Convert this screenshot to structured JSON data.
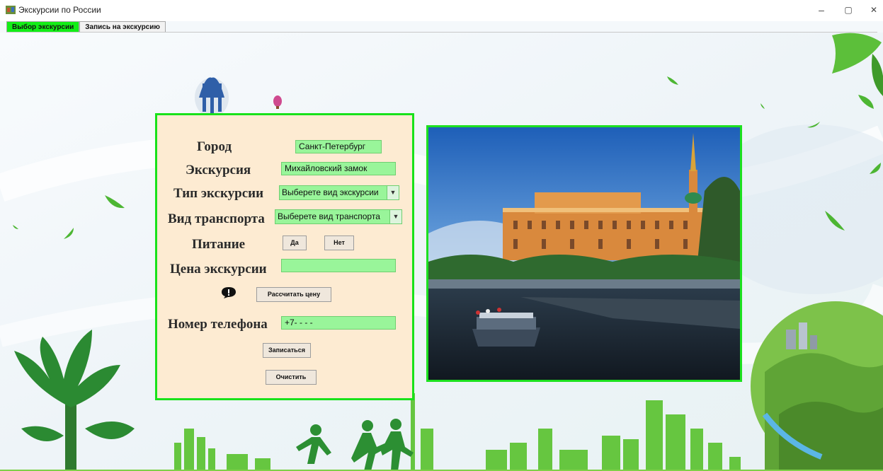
{
  "window": {
    "title": "Экскурсии по России",
    "minimize": "–",
    "maximize": "▢",
    "close": "✕"
  },
  "tabs": [
    {
      "label": "Выбор экскурсии",
      "active": true
    },
    {
      "label": "Запись на экскурсию",
      "active": false
    }
  ],
  "form": {
    "city_label": "Город",
    "city_value": "Санкт-Петербург",
    "excursion_label": "Экскурсия",
    "excursion_value": "Михайловский замок",
    "type_label": "Тип экскурсии",
    "type_value": "Выберете вид экскурсии",
    "transport_label": "Вид транспорта",
    "transport_value": "Выберете вид транспорта",
    "food_label": "Питание",
    "food_yes": "Да",
    "food_no": "Нет",
    "price_label": "Цена экскурсии",
    "price_value": "",
    "calc_button": "Рассчитать цену",
    "phone_label": "Номер телефона",
    "phone_value": "+7-   -   -   -",
    "submit_button": "Записаться",
    "clear_button": "Очистить"
  },
  "colors": {
    "active_tab": "#13ee17",
    "panel_bg": "#fdebd2",
    "panel_border": "#18e21a",
    "field_bg": "#99f59a"
  },
  "icons": {
    "app": "app-icon",
    "info": "exclamation-bubble-icon",
    "dropdown": "chevron-down-icon"
  }
}
